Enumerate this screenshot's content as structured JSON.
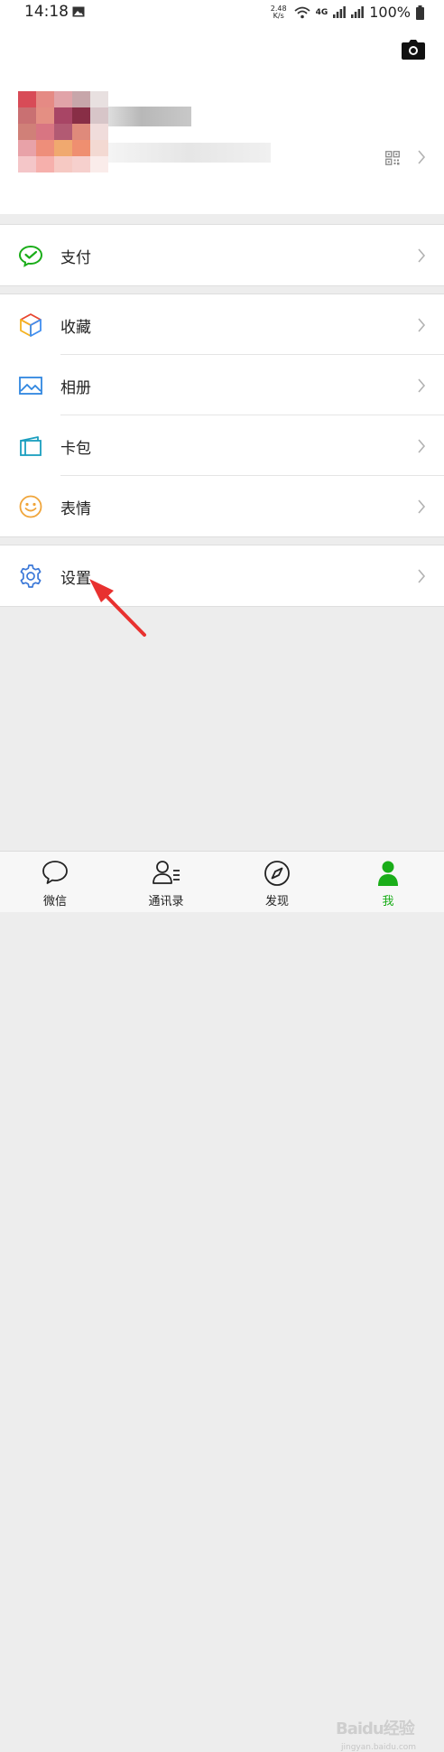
{
  "status_bar": {
    "time": "14:18",
    "net_speed_value": "2.48",
    "net_speed_unit": "K/s",
    "network": "4G",
    "battery": "100%"
  },
  "profile": {
    "avatar_colors": [
      [
        "#d84b57",
        "#e58a84",
        "#e1a3a8",
        "#c7a6aa",
        "#e8e0e0"
      ],
      [
        "#c97072",
        "#e48f83",
        "#a84565",
        "#882e46",
        "#d7c5c8"
      ],
      [
        "#d08078",
        "#d87582",
        "#b25a73",
        "#df8a7b",
        "#f0dcdb"
      ],
      [
        "#e8a2a8",
        "#ee8e7a",
        "#f0a96f",
        "#ef8f70",
        "#f3d9d2"
      ],
      [
        "#f4c6c8",
        "#f6b0ac",
        "#f6c9c3",
        "#f6d0cd",
        "#faecea"
      ]
    ]
  },
  "menu_groups": [
    {
      "items": [
        {
          "label": "支付",
          "icon": "wechat-pay-icon"
        }
      ]
    },
    {
      "items": [
        {
          "label": "收藏",
          "icon": "favorites-cube-icon"
        },
        {
          "label": "相册",
          "icon": "album-picture-icon"
        },
        {
          "label": "卡包",
          "icon": "card-wallet-icon"
        },
        {
          "label": "表情",
          "icon": "sticker-smile-icon"
        }
      ]
    },
    {
      "items": [
        {
          "label": "设置",
          "icon": "settings-gear-icon"
        }
      ]
    }
  ],
  "tabs": [
    {
      "label": "微信",
      "icon": "chat-bubble-icon",
      "active": false
    },
    {
      "label": "通讯录",
      "icon": "contacts-icon",
      "active": false
    },
    {
      "label": "发现",
      "icon": "compass-icon",
      "active": false
    },
    {
      "label": "我",
      "icon": "me-person-icon",
      "active": true
    }
  ],
  "watermark": {
    "text": "Baidu经验",
    "sub": "jingyan.baidu.com"
  },
  "colors": {
    "accent": "#1aad19",
    "annotation_arrow": "#e8312f",
    "page_bg": "#ededed"
  }
}
